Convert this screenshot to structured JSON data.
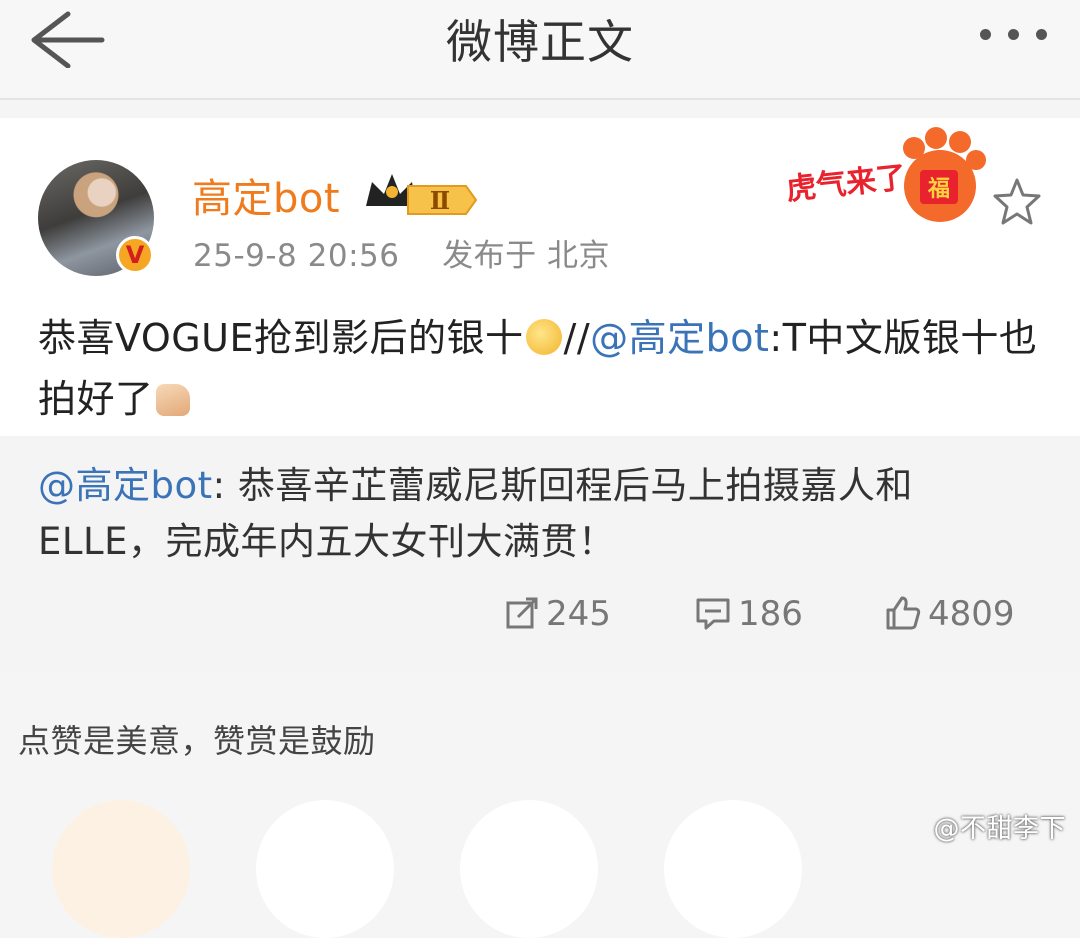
{
  "header": {
    "title": "微博正文",
    "back_icon": "arrow-left-icon",
    "more_icon": "more-dots-icon"
  },
  "post": {
    "username": "高定bot",
    "member_level": "Ⅱ",
    "verified_badge": "V",
    "timestamp": "25-9-8 20:56",
    "location": "发布于 北京",
    "sticker": "虎气来了",
    "sticker_badge": "福",
    "content": {
      "part1": "恭喜VOGUE抢到影后的银十",
      "separator": "//",
      "mention": "@高定bot",
      "part2": ":T中文版银十也拍好了"
    }
  },
  "quoted": {
    "mention": "@高定bot",
    "text": ": 恭喜辛芷蕾威尼斯回程后马上拍摄嘉人和ELLE，完成年内五大女刊大满贯！"
  },
  "actions": {
    "reposts": "245",
    "comments": "186",
    "likes": "4809"
  },
  "reward": {
    "label": "点赞是美意，赞赏是鼓励"
  },
  "watermark": "@不甜李下",
  "colors": {
    "username": "#f07b1c",
    "mention": "#3a73b8",
    "verified": "#f5a623"
  }
}
